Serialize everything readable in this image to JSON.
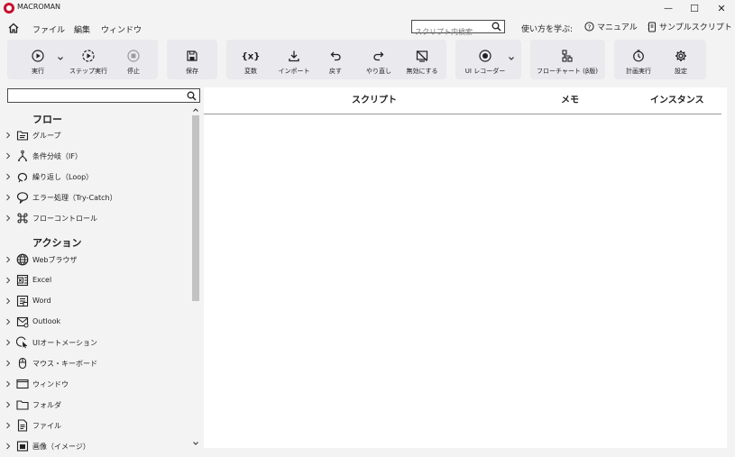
{
  "app": {
    "title": "MACROMAN"
  },
  "window_controls": {
    "minimize": "—",
    "maximize": "☐",
    "close": "✕"
  },
  "menu": {
    "items": [
      "ファイル",
      "編集",
      "ウィンドウ"
    ]
  },
  "search": {
    "placeholder": "スクリプト内検索"
  },
  "help": {
    "learn_label": "使い方を学ぶ:",
    "manual": "マニュアル",
    "samples": "サンプルスクリプト"
  },
  "toolbar": {
    "run": "実行",
    "step_run": "ステップ実行",
    "stop": "停止",
    "save": "保存",
    "variable": "変数",
    "import": "インポート",
    "undo": "戻す",
    "redo": "やり直し",
    "disable": "無効にする",
    "ui_recorder": "UI レコーダー",
    "flowchart": "フローチャート (β版)",
    "schedule": "計画実行",
    "settings": "設定"
  },
  "sidebar": {
    "flow_section": "フロー",
    "flow_items": [
      "グループ",
      "条件分岐（IF）",
      "繰り返し（Loop）",
      "エラー処理（Try-Catch）",
      "フローコントロール"
    ],
    "action_section": "アクション",
    "action_items": [
      "Webブラウザ",
      "Excel",
      "Word",
      "Outlook",
      "UIオートメーション",
      "マウス・キーボード",
      "ウィンドウ",
      "フォルダ",
      "ファイル",
      "画像（イメージ）"
    ]
  },
  "table": {
    "columns": [
      "スクリプト",
      "メモ",
      "インスタンス"
    ]
  }
}
